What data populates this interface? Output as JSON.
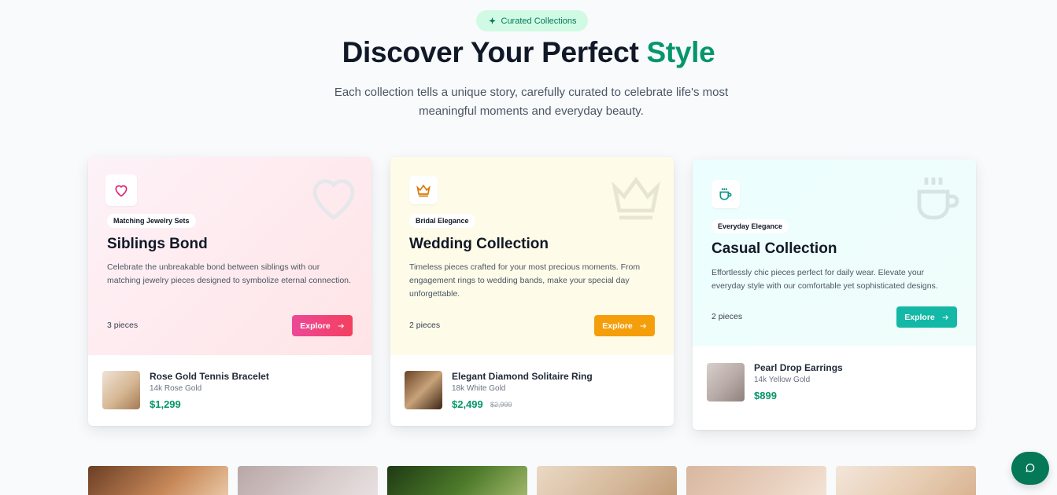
{
  "header": {
    "pill_label": "Curated Collections",
    "title_main": "Discover Your Perfect",
    "title_accent": "Style",
    "subtitle": "Each collection tells a unique story, carefully curated to celebrate life's most meaningful moments and everyday beauty."
  },
  "collections": [
    {
      "icon": "heart-icon",
      "tag": "Matching Jewelry Sets",
      "title": "Siblings Bond",
      "description": "Celebrate the unbreakable bond between siblings with our matching jewelry pieces designed to symbolize eternal connection.",
      "pieces": "3 pieces",
      "explore_label": "Explore",
      "accent": "#ec4899",
      "product": {
        "name": "Rose Gold Tennis Bracelet",
        "metal": "14k Rose Gold",
        "price": "$1,299",
        "old_price": ""
      }
    },
    {
      "icon": "crown-icon",
      "tag": "Bridal Elegance",
      "title": "Wedding Collection",
      "description": "Timeless pieces crafted for your most precious moments. From engagement rings to wedding bands, make your special day unforgettable.",
      "pieces": "2 pieces",
      "explore_label": "Explore",
      "accent": "#f59e0b",
      "product": {
        "name": "Elegant Diamond Solitaire Ring",
        "metal": "18k White Gold",
        "price": "$2,499",
        "old_price": "$2,999"
      }
    },
    {
      "icon": "coffee-cup-icon",
      "tag": "Everyday Elegance",
      "title": "Casual Collection",
      "description": "Effortlessly chic pieces perfect for daily wear. Elevate your everyday style with our comfortable yet sophisticated designs.",
      "pieces": "2 pieces",
      "explore_label": "Explore",
      "accent": "#14b8a6",
      "product": {
        "name": "Pearl Drop Earrings",
        "metal": "14k Yellow Gold",
        "price": "$899",
        "old_price": ""
      }
    }
  ],
  "colors": {
    "brand": "#059669",
    "chat": "#047857"
  },
  "chat_icon": "chat-bubble-icon"
}
